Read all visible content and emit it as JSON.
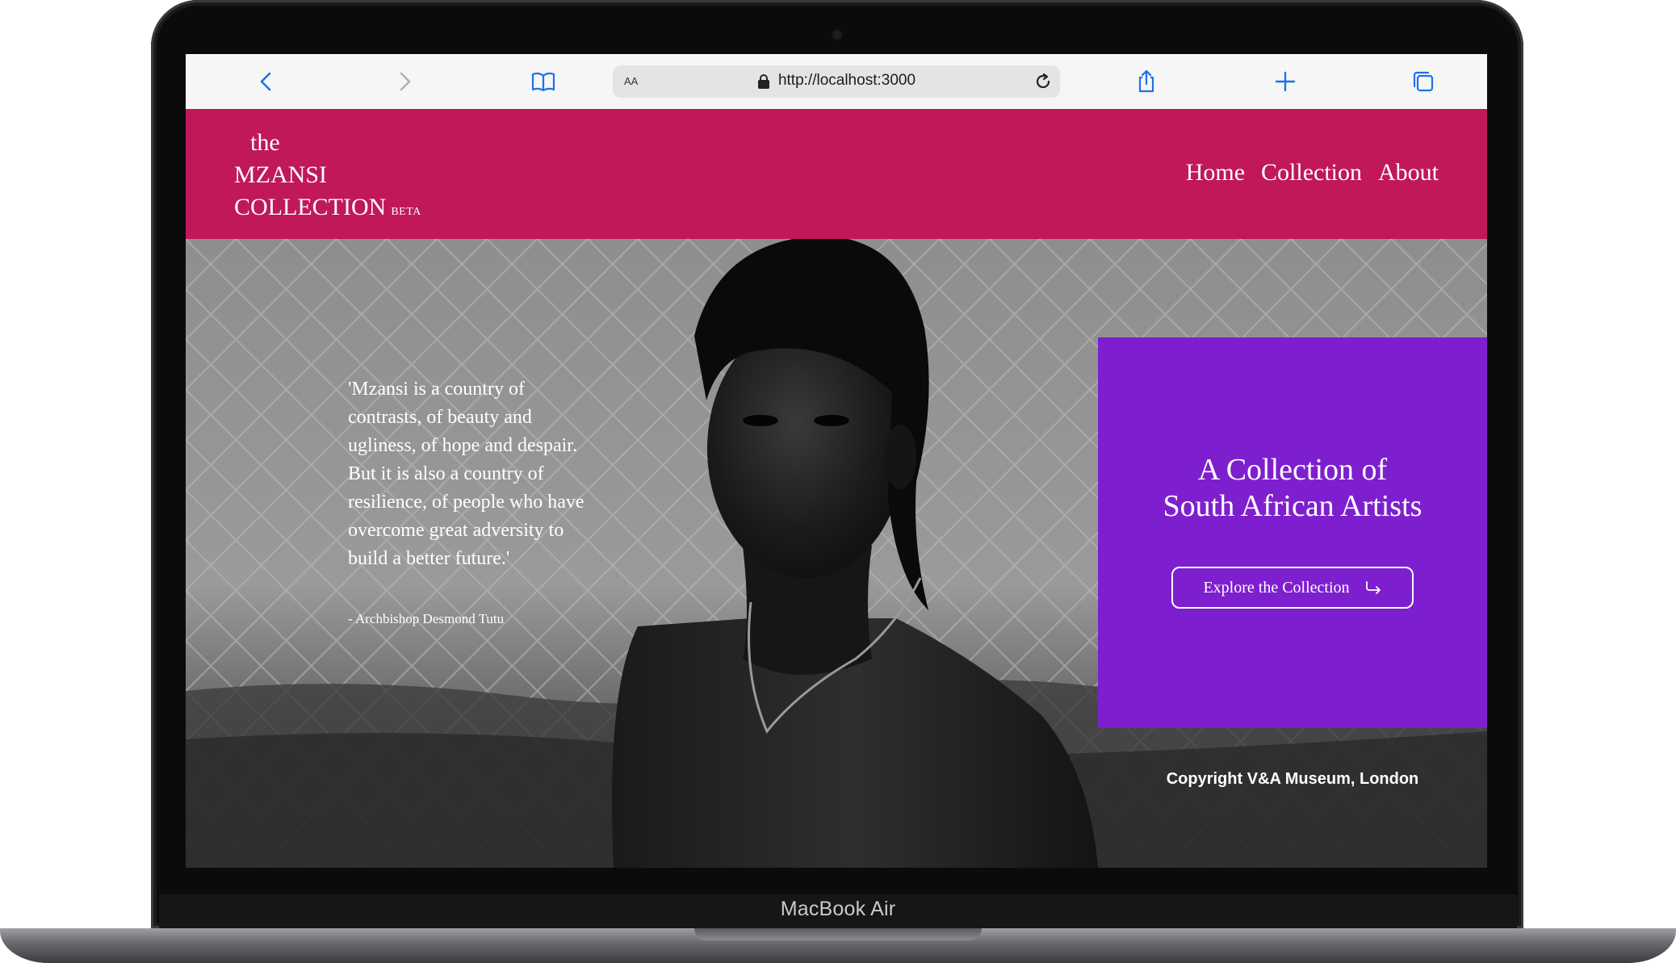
{
  "device": {
    "model_label": "MacBook Air"
  },
  "browser": {
    "text_size_label": "AA",
    "url": "http://localhost:3000",
    "icons": [
      "back-icon",
      "forward-icon",
      "bookmarks-icon",
      "lock-icon",
      "reload-icon",
      "share-icon",
      "new-tab-icon",
      "tabs-icon"
    ]
  },
  "site": {
    "logo": {
      "line1": "the",
      "line2": "MZANSI",
      "line3": "COLLECTION",
      "badge": "BETA"
    },
    "nav": {
      "items": [
        {
          "label": "Home"
        },
        {
          "label": "Collection"
        },
        {
          "label": "About"
        }
      ]
    },
    "colors": {
      "header": "#c0185a",
      "card": "#7e1fcf"
    }
  },
  "hero": {
    "quote": "'Mzansi is a country of contrasts, of beauty and ugliness, of hope and despair. But it is also a country of resilience, of people who have overcome great adversity to build a better future.'",
    "quote_author": "- Archbishop Desmond Tutu",
    "card": {
      "title_line1": "A Collection of",
      "title_line2": "South African Artists",
      "button_label": "Explore the Collection",
      "button_icon": "arrow-right-icon"
    },
    "photo_credit": "Copyright V&A Museum, London"
  }
}
